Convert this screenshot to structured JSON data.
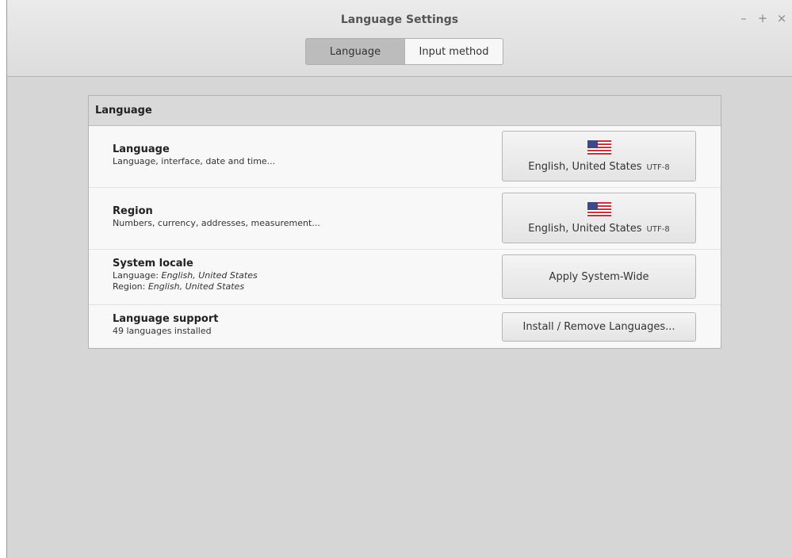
{
  "window": {
    "title": "Language Settings",
    "controls": {
      "minimize": "–",
      "maximize": "+",
      "close": "×"
    }
  },
  "tabs": [
    {
      "label": "Language",
      "active": true
    },
    {
      "label": "Input method",
      "active": false
    }
  ],
  "section": {
    "header": "Language",
    "rows": [
      {
        "title": "Language",
        "subtitle": "Language, interface, date and time...",
        "button": {
          "flag_icon": "us-flag-icon",
          "label": "English, United States",
          "encoding": "UTF-8"
        }
      },
      {
        "title": "Region",
        "subtitle": "Numbers, currency, addresses, measurement...",
        "button": {
          "flag_icon": "us-flag-icon",
          "label": "English, United States",
          "encoding": "UTF-8"
        }
      },
      {
        "title": "System locale",
        "language_prefix": "Language: ",
        "language_value": "English, United States",
        "region_prefix": "Region: ",
        "region_value": "English, United States",
        "button": {
          "label": "Apply System-Wide"
        }
      },
      {
        "title": "Language support",
        "subtitle": "49 languages installed",
        "button": {
          "label": "Install / Remove Languages..."
        }
      }
    ]
  },
  "colors": {
    "window_bg": "#d6d6d6",
    "panel_bg": "#f8f8f8",
    "active_tab": "#bcbcbc"
  }
}
